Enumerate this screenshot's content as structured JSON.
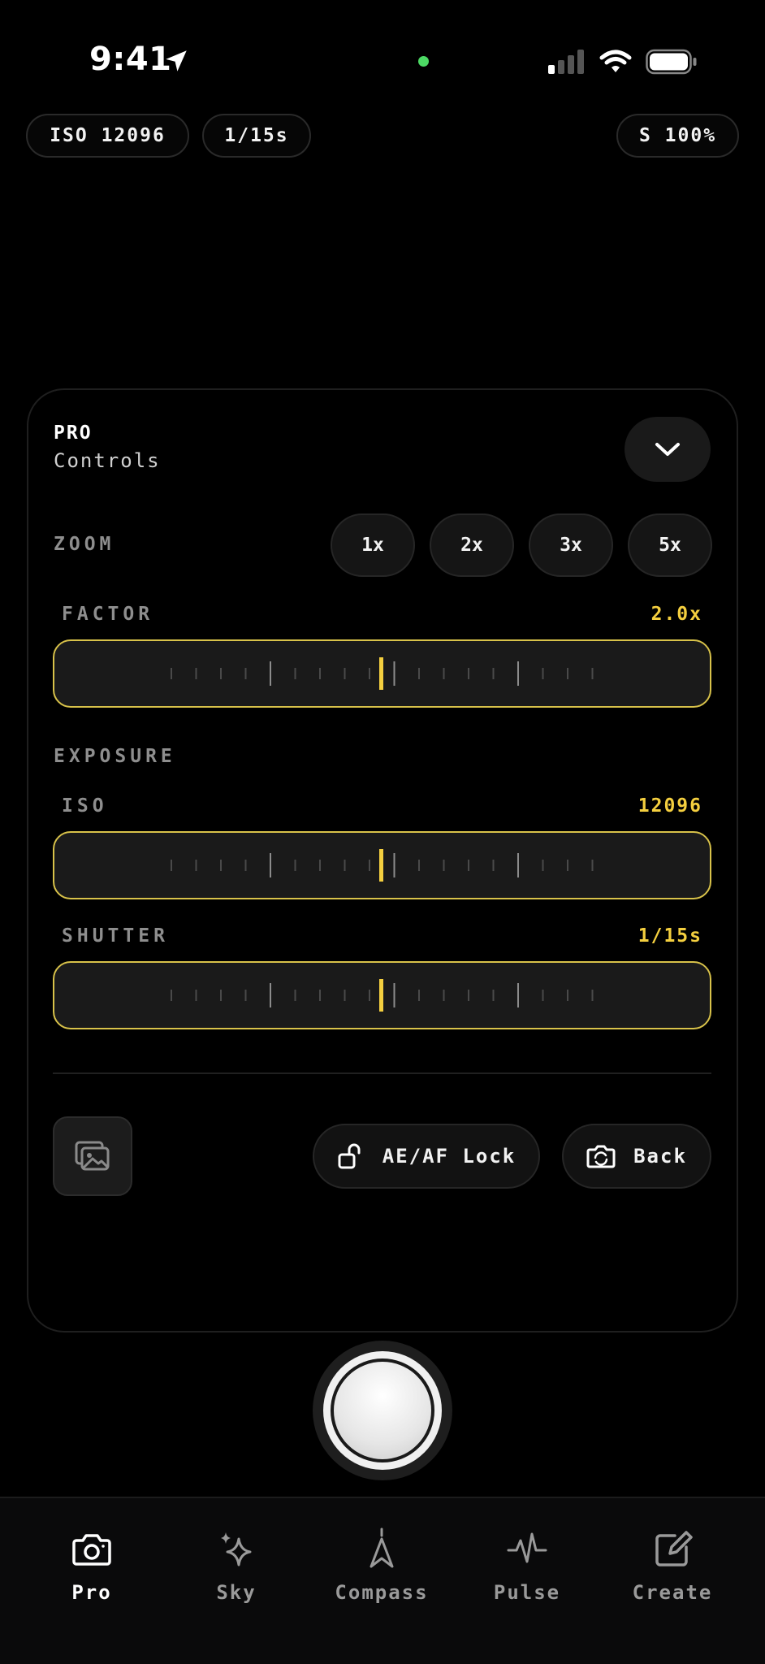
{
  "status_bar": {
    "time": "9:41"
  },
  "top_pills": {
    "iso": "ISO 12096",
    "shutter": "1/15s",
    "stabilization": "S 100%"
  },
  "panel": {
    "title_top": "PRO",
    "title_bottom": "Controls",
    "zoom": {
      "label": "ZOOM",
      "options": [
        "1x",
        "2x",
        "3x",
        "5x"
      ]
    },
    "factor": {
      "label": "FACTOR",
      "value": "2.0x"
    },
    "exposure_label": "EXPOSURE",
    "iso": {
      "label": "ISO",
      "value": "12096"
    },
    "shutter": {
      "label": "SHUTTER",
      "value": "1/15s"
    },
    "ae_af_lock_label": "AE/AF Lock",
    "back_label": "Back"
  },
  "tabs": [
    {
      "label": "Pro",
      "icon": "camera-icon",
      "active": true
    },
    {
      "label": "Sky",
      "icon": "sparkle-icon",
      "active": false
    },
    {
      "label": "Compass",
      "icon": "compass-icon",
      "active": false
    },
    {
      "label": "Pulse",
      "icon": "pulse-icon",
      "active": false
    },
    {
      "label": "Create",
      "icon": "edit-icon",
      "active": false
    }
  ],
  "colors": {
    "accent": "#f4cf3f",
    "background": "#000000",
    "status_dot": "#4cd964"
  }
}
